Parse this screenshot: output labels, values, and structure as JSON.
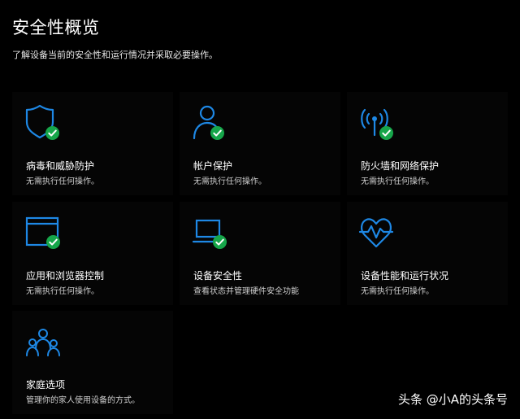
{
  "header": {
    "title": "安全性概览",
    "subtitle": "了解设备当前的安全性和运行情况并采取必要操作。"
  },
  "tiles": [
    {
      "label": "病毒和威胁防护",
      "desc": "无需执行任何操作。",
      "icon": "shield-icon",
      "status": "ok"
    },
    {
      "label": "帐户保护",
      "desc": "无需执行任何操作。",
      "icon": "person-icon",
      "status": "ok"
    },
    {
      "label": "防火墙和网络保护",
      "desc": "无需执行任何操作。",
      "icon": "wireless-antenna-icon",
      "status": "ok"
    },
    {
      "label": "应用和浏览器控制",
      "desc": "无需执行任何操作。",
      "icon": "app-window-icon",
      "status": "ok"
    },
    {
      "label": "设备安全性",
      "desc": "查看状态并管理硬件安全功能",
      "icon": "laptop-icon",
      "status": "ok"
    },
    {
      "label": "设备性能和运行状况",
      "desc": "无需执行任何操作。",
      "icon": "heart-pulse-icon",
      "status": "none"
    },
    {
      "label": "家庭选项",
      "desc": "管理你的家人使用设备的方式。",
      "icon": "family-icon",
      "status": "none"
    }
  ],
  "watermark": "头条 @小A的头条号",
  "colors": {
    "background": "#000000",
    "tile": "#050505",
    "accent_blue": "#1e88e5",
    "check_green": "#16a64a"
  }
}
